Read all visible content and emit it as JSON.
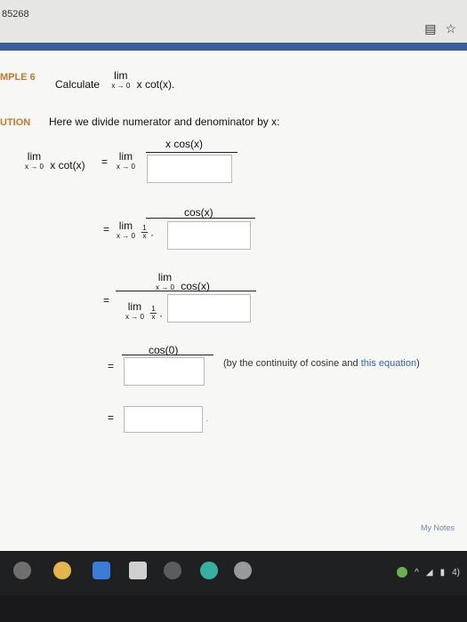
{
  "browser": {
    "url_fragment": "85268",
    "icons": [
      "book-icon",
      "star-icon"
    ]
  },
  "problem": {
    "label": "MPLE 6",
    "prompt_text": "Calculate",
    "lim_word": "lim",
    "lim_sub": "x → 0",
    "expression": "x cot(x)."
  },
  "solution": {
    "label": "UTION",
    "intro": "Here we divide numerator and denominator by x:",
    "row1": {
      "lhs_lim": "lim",
      "lhs_sub": "x → 0",
      "lhs_expr": "x cot(x)",
      "eq": "=",
      "rhs_lim": "lim",
      "rhs_sub": "x → 0",
      "numerator": "x cos(x)"
    },
    "row2": {
      "eq": "=",
      "lim": "lim",
      "sub": "x → 0",
      "numerator": "cos(x)",
      "frac_num": "1",
      "frac_den": "x",
      "dot": "·"
    },
    "row3": {
      "eq": "=",
      "num_lim": "lim",
      "num_sub": "x → 0",
      "numerator": "cos(x)",
      "den_lim": "lim",
      "den_sub": "x → 0",
      "frac_num": "1",
      "frac_den": "x",
      "dot": "·"
    },
    "row4": {
      "eq": "=",
      "numerator": "cos(0)",
      "note_prefix": "(by the continuity of cosine and ",
      "note_link": "this equation",
      "note_suffix": ")"
    },
    "row5": {
      "eq": "=",
      "period": "."
    }
  },
  "footer": {
    "my_notes": "My Notes"
  },
  "taskbar": {
    "tray_time": "4)"
  }
}
